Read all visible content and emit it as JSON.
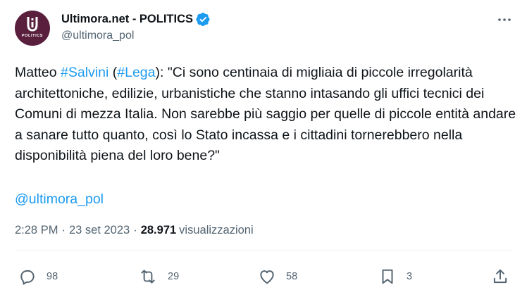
{
  "account": {
    "display_name": "Ultimora.net - POLITICS",
    "handle": "@ultimora_pol",
    "avatar_text": "POLITICS",
    "avatar_color": "#5a1f3d",
    "verified_color": "#1d9bf0"
  },
  "tweet": {
    "t1": "Matteo ",
    "hashtag1": "#Salvini",
    "t2": " (",
    "hashtag2": "#Lega",
    "t3": "): \"Ci sono centinaia di migliaia di piccole irregolarità architettoniche, edilizie, urbanistiche che stanno intasando gli uffici tecnici dei Comuni di mezza Italia. Non sarebbe più saggio per quelle di piccole entità andare a sanare tutto quanto, così lo Stato incassa e i cittadini tornerebbero nella disponibilità piena del loro bene?\"",
    "mention": "@ultimora_pol"
  },
  "meta": {
    "time": "2:28 PM",
    "separator": "·",
    "date": "23 set 2023",
    "views_count": "28.971",
    "views_label": "visualizzazioni"
  },
  "actions": {
    "replies": "98",
    "retweets": "29",
    "likes": "58",
    "bookmarks": "3"
  },
  "icons": {
    "avatar": "ultimora-logo-icon",
    "verified": "verified-badge-icon",
    "more": "more-options-icon",
    "reply": "reply-icon",
    "retweet": "retweet-icon",
    "like": "heart-icon",
    "bookmark": "bookmark-icon",
    "share": "share-icon"
  },
  "colors": {
    "link": "#1d9bf0",
    "text": "#0f1419",
    "secondary": "#536471"
  }
}
